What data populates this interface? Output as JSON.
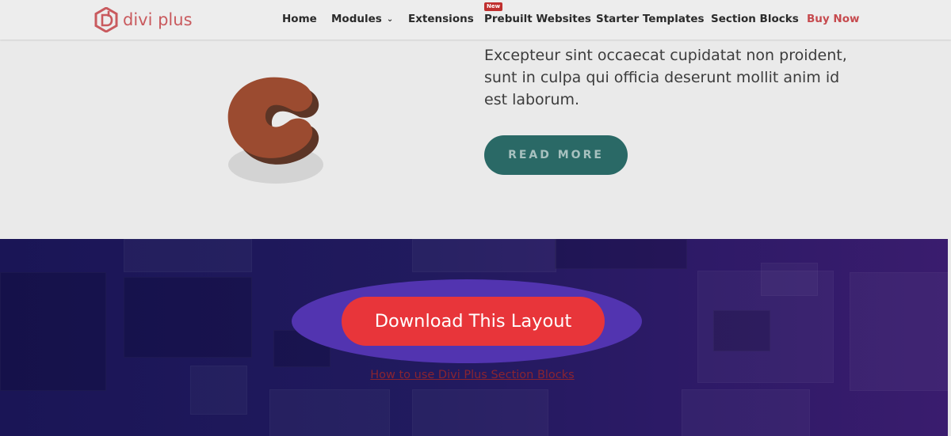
{
  "header": {
    "logo_text": "divi plus",
    "nav": [
      {
        "label": "Home"
      },
      {
        "label": "Modules"
      },
      {
        "label": "Extensions"
      },
      {
        "label": "Prebuilt Websites",
        "badge": "New"
      },
      {
        "label": "Starter Templates"
      },
      {
        "label": "Section Blocks"
      },
      {
        "label": "Buy Now"
      }
    ]
  },
  "content": {
    "paragraph": "Excepteur sint occaecat cupidatat non proident, sunt in culpa qui officia deserunt mollit anim id est laborum.",
    "read_more_label": "READ MORE"
  },
  "cta": {
    "download_label": "Download This Layout",
    "howto_link": "How to use Divi Plus Section Blocks"
  },
  "colors": {
    "brand": "#c95a5e",
    "buy_now": "#c64a4e",
    "read_more_bg": "#2a6966",
    "download_bg": "#e8353a",
    "highlight": "#5234b0",
    "purple_bg": "#211a5e"
  },
  "icons": [
    "divi-plus-logo-icon",
    "chevron-down-icon",
    "3d-c-shape-icon"
  ]
}
